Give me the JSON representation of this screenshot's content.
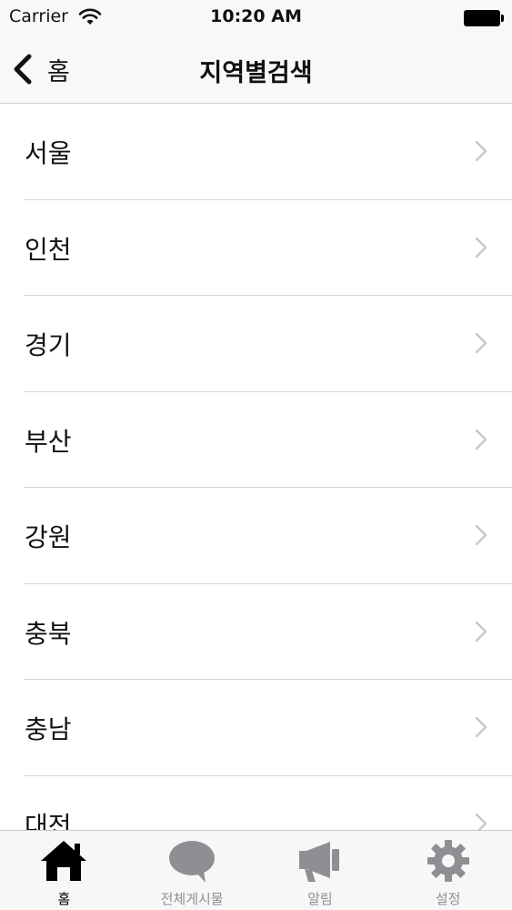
{
  "status_bar": {
    "carrier": "Carrier",
    "time": "10:20 AM"
  },
  "nav": {
    "back_label": "홈",
    "title": "지역별검색"
  },
  "regions": [
    {
      "label": "서울"
    },
    {
      "label": "인천"
    },
    {
      "label": "경기"
    },
    {
      "label": "부산"
    },
    {
      "label": "강원"
    },
    {
      "label": "충북"
    },
    {
      "label": "충남"
    },
    {
      "label": "대전"
    }
  ],
  "tabs": [
    {
      "label": "홈",
      "icon": "house-icon",
      "active": true
    },
    {
      "label": "전체게시물",
      "icon": "speech-bubble-icon",
      "active": false
    },
    {
      "label": "알림",
      "icon": "megaphone-icon",
      "active": false
    },
    {
      "label": "설정",
      "icon": "gear-icon",
      "active": false
    }
  ],
  "colors": {
    "active_tab": "#000000",
    "inactive_tab": "#8e8e93",
    "chevron": "#c7c7cc",
    "separator": "#d6d6da"
  }
}
